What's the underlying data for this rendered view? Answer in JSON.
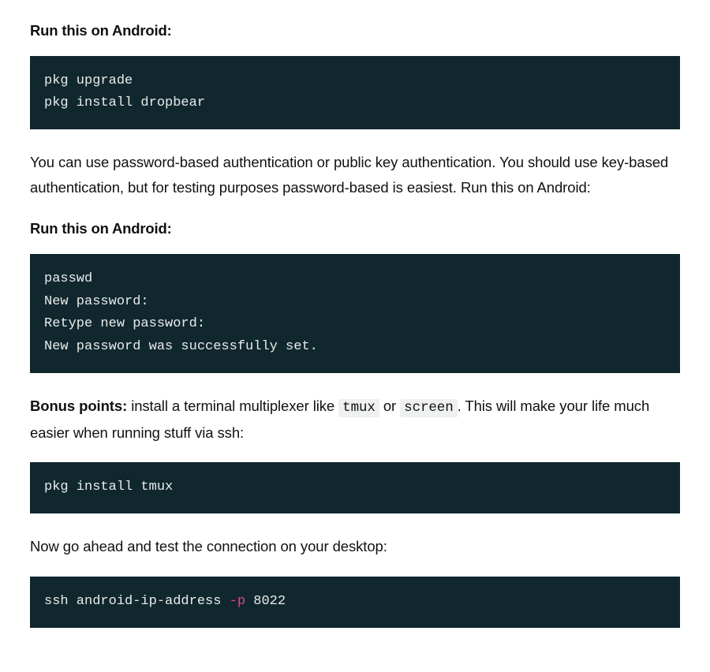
{
  "heading1": "Run this on Android:",
  "code1_line1": "pkg upgrade",
  "code1_line2": "pkg install dropbear",
  "para1": "You can use password-based authentication or public key authentication. You should use key-based authentication, but for testing purposes password-based is easiest. Run this on Android:",
  "heading2": "Run this on Android:",
  "code2_line1": "passwd",
  "code2_line2": "New password:",
  "code2_line3": "Retype new password:",
  "code2_line4": "New password was successfully set.",
  "para2_strong": "Bonus points:",
  "para2_part1": " install a terminal multiplexer like ",
  "para2_code1": "tmux",
  "para2_part2": " or ",
  "para2_code2": "screen",
  "para2_part3": ". This will make your life much easier when running stuff via ssh:",
  "code3_line1": "pkg install tmux",
  "para3": "Now go ahead and test the connection on your desktop:",
  "code4_part1": "ssh android-ip-address ",
  "code4_flag": "-p",
  "code4_part2": " 8022"
}
